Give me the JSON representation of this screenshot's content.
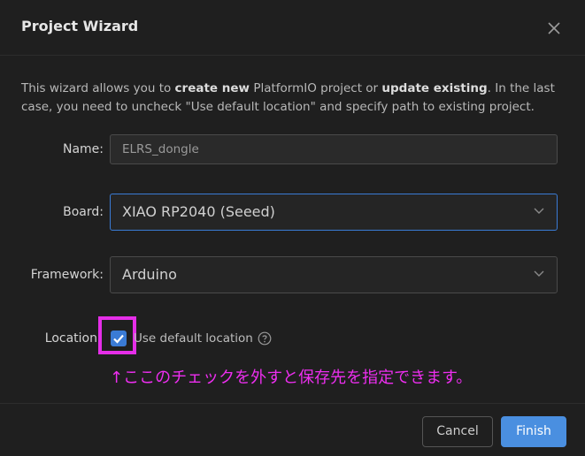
{
  "dialog": {
    "title": "Project Wizard",
    "description": {
      "part1": "This wizard allows you to ",
      "bold1": "create new",
      "part2": " PlatformIO project or ",
      "bold2": "update existing",
      "part3": ". In the last case, you need to uncheck \"Use default location\" and specify path to existing project."
    }
  },
  "form": {
    "name_label": "Name:",
    "name_value": "ELRS_dongle",
    "board_label": "Board:",
    "board_value": "XIAO RP2040 (Seeed)",
    "framework_label": "Framework:",
    "framework_value": "Arduino",
    "location_label": "Location",
    "use_default_label": "Use default location",
    "use_default_checked": true
  },
  "annotation": {
    "text": "↑ここのチェックを外すと保存先を指定できます。",
    "color": "#ee2ef0"
  },
  "footer": {
    "cancel_label": "Cancel",
    "finish_label": "Finish"
  },
  "colors": {
    "accent": "#4a8fe0",
    "highlight_box": "#e52ee8"
  },
  "icons": {
    "close": "close-icon",
    "chevron": "chevron-down-icon",
    "check": "check-icon",
    "help": "help-circle-icon"
  }
}
